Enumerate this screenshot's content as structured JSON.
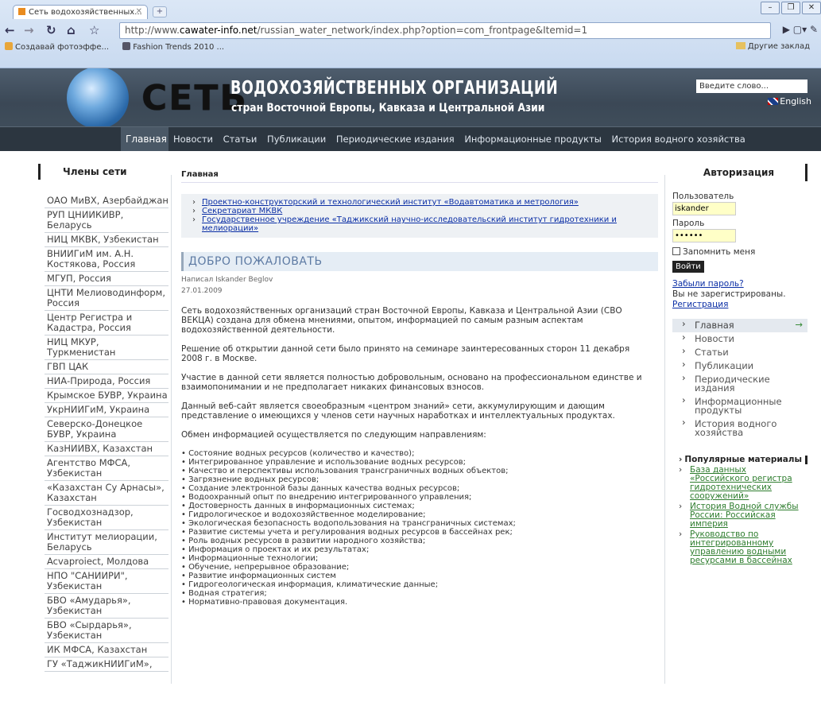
{
  "browser": {
    "tab_title": "Сеть водохозяйственных...",
    "url_prefix": "http://www.",
    "url_domain": "cawater-info.net",
    "url_path": "/russian_water_network/index.php?option=com_frontpage&Itemid=1",
    "bookmarks": [
      "Создавай фотоэффе...",
      "Fashion Trends 2010 ..."
    ],
    "other_bookmarks": "Другие заклад"
  },
  "header": {
    "logo_big": "СЕТЬ",
    "logo_line1": "ВОДОХОЗЯЙСТВЕННЫХ ОРГАНИЗАЦИЙ",
    "logo_line2": "стран Восточной Европы, Кавказа и Центральной Азии",
    "search_value": "Введите слово...",
    "lang": "English"
  },
  "nav": {
    "active": "Главная",
    "items": [
      "Новости",
      "Статьи",
      "Публикации",
      "Периодические издания",
      "Информационные продукты",
      "История водного хозяйства"
    ]
  },
  "left": {
    "title": "Члены сети",
    "members": [
      "ОАО МиВХ, Азербайджан",
      "РУП ЦНИИКИВР, Беларусь",
      "НИЦ МКВК, Узбекистан",
      "ВНИИГиМ им. А.Н. Костякова, Россия",
      "МГУП, Россия",
      "ЦНТИ Мелиоводинформ, Россия",
      "Центр Регистра и Кадастра, Россия",
      "НИЦ МКУР, Туркменистан",
      "ГВП ЦАК",
      "НИА-Природа, Россия",
      "Крымское БУВР, Украина",
      "УкрНИИГиМ, Украина",
      "Северско-Донецкое БУВР, Украина",
      "КазНИИВХ, Казахстан",
      "Агентство МФСА, Узбекистан",
      "«Казахстан Су Арнасы», Казахстан",
      "Госводхознадзор, Узбекистан",
      "Институт мелиорации, Беларусь",
      "Acvaproiect, Молдова",
      "НПО \"САНИИРИ\", Узбекистан",
      "БВО «Амударья», Узбекистан",
      "БВО «Сырдарья», Узбекистан",
      "ИК МФСА, Казахстан",
      "ГУ «ТаджикНИИГиМ»,"
    ]
  },
  "main": {
    "breadcrumb": "Главная",
    "news": [
      "Проектно-конструкторский и технологический институт «Водавтоматика и метрология»",
      "Секретариат МКВК",
      "Государственное учреждение «Таджикский научно-исследовательский институт гидротехники и мелиорации»"
    ],
    "welcome": "ДОБРО ПОЖАЛОВАТЬ",
    "author": "Написал Iskander Beglov",
    "date": "27.01.2009",
    "paragraphs": [
      "Сеть водохозяйственных организаций стран Восточной Европы, Кавказа и Центральной Азии (СВО ВЕКЦА) создана для обмена мнениями, опытом, информацией по самым разным аспектам водохозяйственной деятельности.",
      "Решение об открытии данной сети было принято на семинаре заинтересованных сторон 11 декабря 2008 г. в Москве.",
      "Участие в данной сети является полностью добровольным, основано на профессиональном единстве и взаимопонимании и не предполагает никаких финансовых взносов.",
      "Данный веб-сайт является своеобразным «центром знаний» сети, аккумулирующим и дающим представление о имеющихся у членов сети научных наработках и интеллектуальных продуктах.",
      "Обмен информацией осуществляется по следующим направлениям:"
    ],
    "bullets": [
      "• Состояние водных ресурсов (количество и качество);",
      "• Интегрированное управление и использование водных ресурсов;",
      "• Качество и перспективы использования трансграничных водных объектов;",
      "• Загрязнение водных ресурсов;",
      "• Создание электронной базы данных качества водных ресурсов;",
      "• Водоохранный опыт по внедрению интегрированного управления;",
      "• Достоверность данных в информационных системах;",
      "• Гидрологическое и водохозяйственное моделирование;",
      "• Экологическая безопасность водопользования на трансграничных системах;",
      "• Развитие системы учета и регулирования водных ресурсов в бассейнах рек;",
      "• Роль водных ресурсов в развитии народного хозяйства;",
      "• Информация о проектах и их результатах;",
      "• Информационные технологии;",
      "• Обучение, непрерывное образование;",
      "• Развитие информационных систем",
      "• Гидрогеологическая информация, климатические данные;",
      "• Водная стратегия;",
      "• Нормативно-правовая документация."
    ]
  },
  "right": {
    "auth_title": "Авторизация",
    "user_label": "Пользователь",
    "user_value": "iskander",
    "pass_label": "Пароль",
    "pass_value": "••••••",
    "remember": "Запомнить меня",
    "login": "Войти",
    "forgot": "Забыли пароль?",
    "not_registered": "Вы не зарегистрированы.",
    "register": "Регистрация",
    "menu_active": "Главная",
    "menu_arrow": "→",
    "menu": [
      "Новости",
      "Статьи",
      "Публикации",
      "Периодические издания",
      "Информационные продукты",
      "История водного хозяйства"
    ],
    "popular_title": "Популярные материалы",
    "popular": [
      "База данных «Российского регистра гидротехнических сооружений»",
      "История Водной службы России: Российская империя",
      "Руководство по интегрированному управлению водными ресурсами в бассейнах"
    ]
  }
}
